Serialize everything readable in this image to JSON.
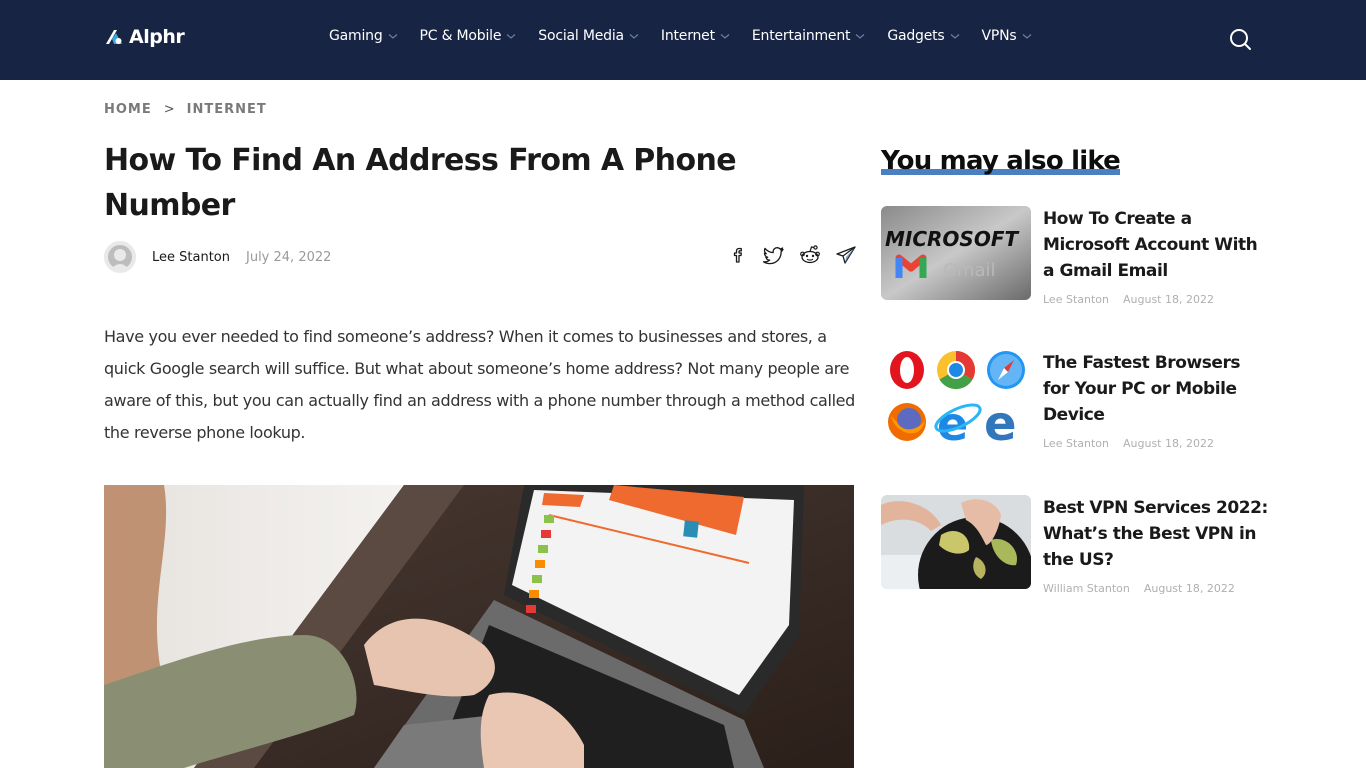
{
  "site": {
    "logo_text": "Alphr",
    "accent": "#4a7fc1",
    "header_bg": "#172443"
  },
  "nav": {
    "items": [
      {
        "label": "Gaming"
      },
      {
        "label": "PC & Mobile"
      },
      {
        "label": "Social Media"
      },
      {
        "label": "Internet"
      },
      {
        "label": "Entertainment"
      },
      {
        "label": "Gadgets"
      },
      {
        "label": "VPNs"
      }
    ],
    "search_icon": "search-icon"
  },
  "breadcrumb": {
    "items": [
      "HOME",
      "INTERNET"
    ],
    "separator": ">"
  },
  "article": {
    "title": "How To Find An Address From A Phone Number",
    "author": "Lee Stanton",
    "date": "July 24, 2022",
    "share": [
      "facebook-icon",
      "twitter-icon",
      "reddit-icon",
      "telegram-icon"
    ],
    "intro": "Have you ever needed to find someone’s address? When it comes to businesses and stores, a quick Google search will suffice. But what about someone’s home address? Not many people are aware of this, but you can actually find an address with a phone number through a method called the reverse phone lookup.",
    "hero_alt": "Person typing on a laptop showing a reverse phone lookup website"
  },
  "sidebar": {
    "title": "You may also like",
    "items": [
      {
        "title": "How To Create a Microsoft Account With a Gmail Email",
        "author": "Lee Stanton",
        "date": "August 18, 2022",
        "thumb_text": "MICROSOFT",
        "thumb_sub": "Gmail"
      },
      {
        "title": "The Fastest Browsers for Your PC or Mobile Device",
        "author": "Lee Stanton",
        "date": "August 18, 2022"
      },
      {
        "title": "Best VPN Services 2022: What’s the Best VPN in the US?",
        "author": "William Stanton",
        "date": "August 18, 2022"
      }
    ]
  }
}
